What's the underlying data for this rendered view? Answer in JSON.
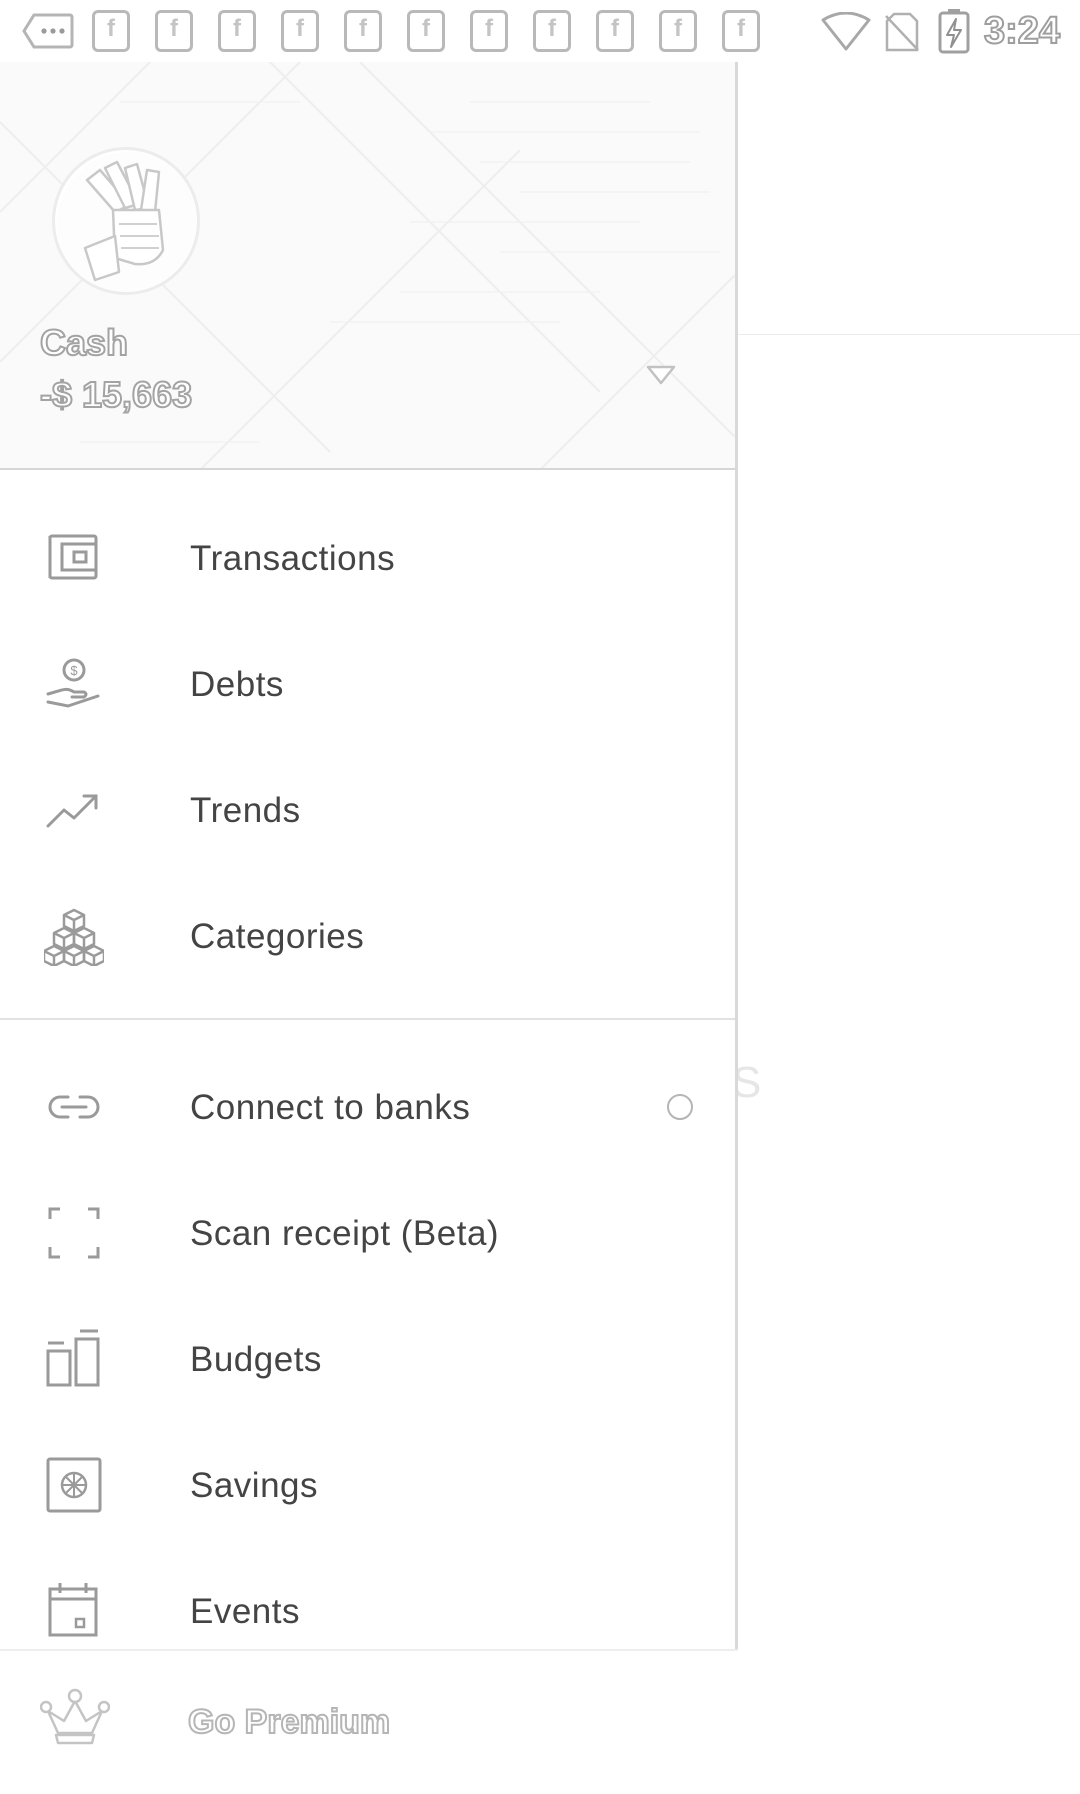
{
  "status_bar": {
    "time": "3:24",
    "notification_letter": "f",
    "notification_count": 11,
    "icons": [
      "more-dots-icon",
      "facebook-notification-icon",
      "wifi-icon",
      "no-sim-icon",
      "battery-charging-icon"
    ]
  },
  "drawer": {
    "account": {
      "name": "Cash",
      "balance": "-$ 15,663"
    },
    "menu_primary": [
      {
        "label": "Transactions",
        "icon": "wallet-icon"
      },
      {
        "label": "Debts",
        "icon": "hand-coin-icon"
      },
      {
        "label": "Trends",
        "icon": "trending-up-icon"
      },
      {
        "label": "Categories",
        "icon": "stacked-boxes-icon"
      }
    ],
    "menu_secondary": [
      {
        "label": "Connect to banks",
        "icon": "link-icon"
      },
      {
        "label": "Scan receipt (Beta)",
        "icon": "scan-frame-icon"
      },
      {
        "label": "Budgets",
        "icon": "budget-bars-icon"
      },
      {
        "label": "Savings",
        "icon": "safe-icon"
      },
      {
        "label": "Events",
        "icon": "calendar-icon"
      }
    ],
    "premium": {
      "label": "Go Premium",
      "icon": "crown-icon"
    }
  },
  "background": {
    "ghost_text": "S"
  },
  "colors": {
    "text": "#444444",
    "icon_stroke": "#9a9a9a",
    "divider": "#e2e2e2",
    "header_bg": "#fafafa"
  }
}
